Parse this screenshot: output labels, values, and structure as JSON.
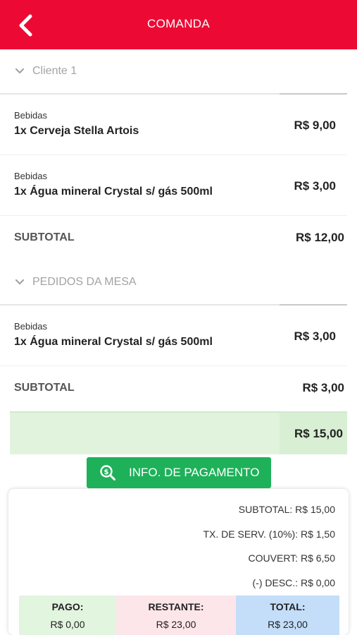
{
  "header": {
    "title": "COMANDA"
  },
  "sections": [
    {
      "title": "Cliente 1",
      "items": [
        {
          "category": "Bebidas",
          "name": "1x Cerveja Stella Artois",
          "price": "R$ 9,00"
        },
        {
          "category": "Bebidas",
          "name": "1x Água mineral Crystal s/ gás 500ml",
          "price": "R$ 3,00"
        }
      ],
      "subtotal_label": "SUBTOTAL",
      "subtotal_value": "R$ 12,00"
    },
    {
      "title": "PEDIDOS DA MESA",
      "items": [
        {
          "category": "Bebidas",
          "name": "1x Água mineral Crystal s/ gás 500ml",
          "price": "R$ 3,00"
        }
      ],
      "subtotal_label": "SUBTOTAL",
      "subtotal_value": "R$ 3,00"
    }
  ],
  "grand_total": "R$ 15,00",
  "payment_button": {
    "label": "INFO. DE PAGAMENTO",
    "icon": "dollar-search-icon"
  },
  "summary": {
    "subtotal": "SUBTOTAL: R$ 15,00",
    "service_fee": "TX. DE SERV. (10%): R$ 1,50",
    "couvert": "COUVERT: R$ 6,50",
    "discount": "(-) DESC.: R$ 0,00",
    "paid_label": "PAGO:",
    "paid_value": "R$ 0,00",
    "remaining_label": "RESTANTE:",
    "remaining_value": "R$ 23,00",
    "total_label": "TOTAL:",
    "total_value": "R$ 23,00"
  },
  "colors": {
    "header": "#ec0a34",
    "pay_button": "#1eb15a",
    "total_band": "#e1f3dd",
    "paid_cell": "#e2f5df",
    "remaining_cell": "#fde6ea",
    "total_cell": "#c4def9"
  }
}
